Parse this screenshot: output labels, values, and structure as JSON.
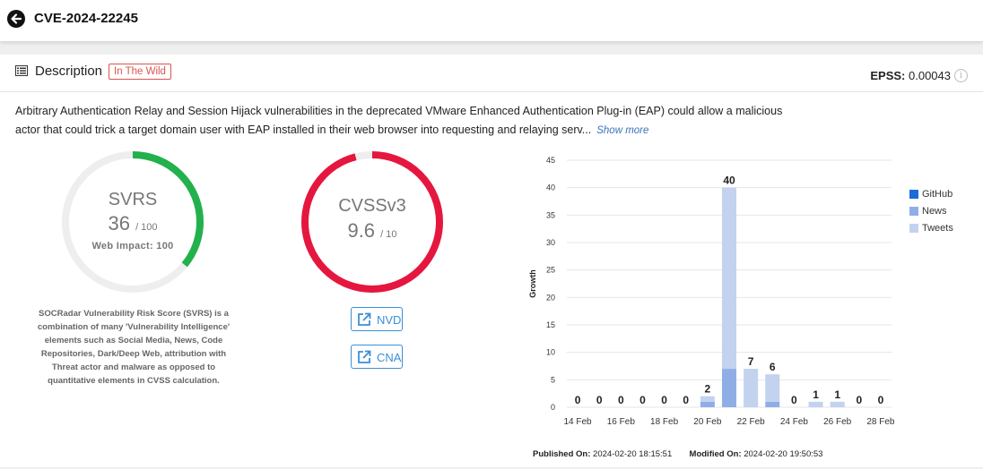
{
  "header": {
    "title": "CVE-2024-22245"
  },
  "description": {
    "heading": "Description",
    "badge": "In The Wild",
    "epss_label": "EPSS:",
    "epss_value": "0.00043",
    "info_glyph": "i",
    "text": "Arbitrary Authentication Relay and Session Hijack vulnerabilities in the deprecated VMware Enhanced Authentication Plug-in (EAP) could allow a malicious actor that could trick a target domain user with EAP installed in their web browser into requesting and relaying serv...",
    "show_more": "Show more"
  },
  "svrs": {
    "title": "SVRS",
    "score": "36",
    "max": "/ 100",
    "web_impact": "Web Impact: 100",
    "score_fraction": 0.36,
    "color": "#22b14c",
    "info": "SOCRadar Vulnerability Risk Score (SVRS) is a combination of many 'Vulnerability Intelligence' elements such as Social Media, News, Code Repositories, Dark/Deep Web, attribution with Threat actor and malware as opposed to quantitative elements in CVSS calculation."
  },
  "cvss": {
    "title": "CVSSv3",
    "score": "9.6",
    "max": "/ 10",
    "score_fraction": 0.96,
    "color": "#e5173f"
  },
  "links": {
    "nvd": "NVD",
    "cna": "CNA"
  },
  "chart_data": {
    "type": "bar",
    "stacked": true,
    "categories": [
      "14 Feb",
      "15 Feb",
      "16 Feb",
      "17 Feb",
      "18 Feb",
      "19 Feb",
      "20 Feb",
      "21 Feb",
      "22 Feb",
      "23 Feb",
      "24 Feb",
      "25 Feb",
      "26 Feb",
      "27 Feb",
      "28 Feb"
    ],
    "tick_labels": [
      "14 Feb",
      "16 Feb",
      "18 Feb",
      "20 Feb",
      "22 Feb",
      "24 Feb",
      "26 Feb",
      "28 Feb"
    ],
    "totals": [
      0,
      0,
      0,
      0,
      0,
      0,
      2,
      40,
      7,
      6,
      0,
      1,
      1,
      0,
      0
    ],
    "series": [
      {
        "name": "GitHub",
        "color": "#1a6bd8",
        "values": [
          0,
          0,
          0,
          0,
          0,
          0,
          0,
          0,
          0,
          0,
          0,
          0,
          0,
          0,
          0
        ]
      },
      {
        "name": "News",
        "color": "#8faee6",
        "values": [
          0,
          0,
          0,
          0,
          0,
          0,
          1,
          7,
          0,
          1,
          0,
          0,
          0,
          0,
          0
        ]
      },
      {
        "name": "Tweets",
        "color": "#c3d2ee",
        "values": [
          0,
          0,
          0,
          0,
          0,
          0,
          1,
          33,
          7,
          5,
          0,
          1,
          1,
          0,
          0
        ]
      }
    ],
    "ylabel": "Growth",
    "ylim": [
      0,
      45
    ],
    "yticks": [
      0,
      5,
      10,
      15,
      20,
      25,
      30,
      35,
      40,
      45
    ],
    "grid": true,
    "legend": "right"
  },
  "dates": {
    "published_label": "Published On:",
    "published_value": "2024-02-20 18:15:51",
    "modified_label": "Modified On:",
    "modified_value": "2024-02-20 19:50:53"
  }
}
